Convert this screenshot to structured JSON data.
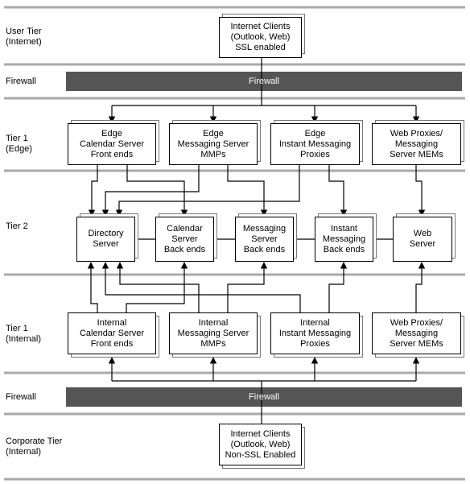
{
  "tiers": [
    {
      "id": "user",
      "label": "User Tier\n(Internet)"
    },
    {
      "id": "fw1",
      "label": "Firewall"
    },
    {
      "id": "edge",
      "label": "Tier 1\n(Edge)"
    },
    {
      "id": "tier2",
      "label": "Tier 2"
    },
    {
      "id": "internal",
      "label": "Tier 1\n(Internal)"
    },
    {
      "id": "fw2",
      "label": "Firewall"
    },
    {
      "id": "corporate",
      "label": "Corporate Tier\n(Internal)"
    }
  ],
  "firewalls": [
    {
      "label": "Firewall"
    },
    {
      "label": "Firewall"
    }
  ],
  "nodes": {
    "internet_clients": "Internet Clients\n(Outlook, Web)\nSSL enabled",
    "edge": [
      "Edge\nCalendar Server\nFront ends",
      "Edge\nMessaging Server\nMMPs",
      "Edge\nInstant Messaging\nProxies",
      "Web Proxies/\nMessaging\nServer MEMs"
    ],
    "tier2": [
      "Directory\nServer",
      "Calendar\nServer\nBack ends",
      "Messaging\nServer\nBack ends",
      "Instant\nMessaging\nBack ends",
      "Web\nServer"
    ],
    "internal": [
      "Internal\nCalendar Server\nFront ends",
      "Internal\nMessaging Server\nMMPs",
      "Internal\nInstant Messaging\nProxies",
      "Web Proxies/\nMessaging\nServer MEMs"
    ],
    "corporate_clients": "Internet Clients\n(Outlook, Web)\nNon-SSL Enabled"
  },
  "colors": {
    "separator": "#aaaaaa",
    "firewall": "#555555",
    "line": "#000000",
    "shadow_border": "#777777"
  }
}
